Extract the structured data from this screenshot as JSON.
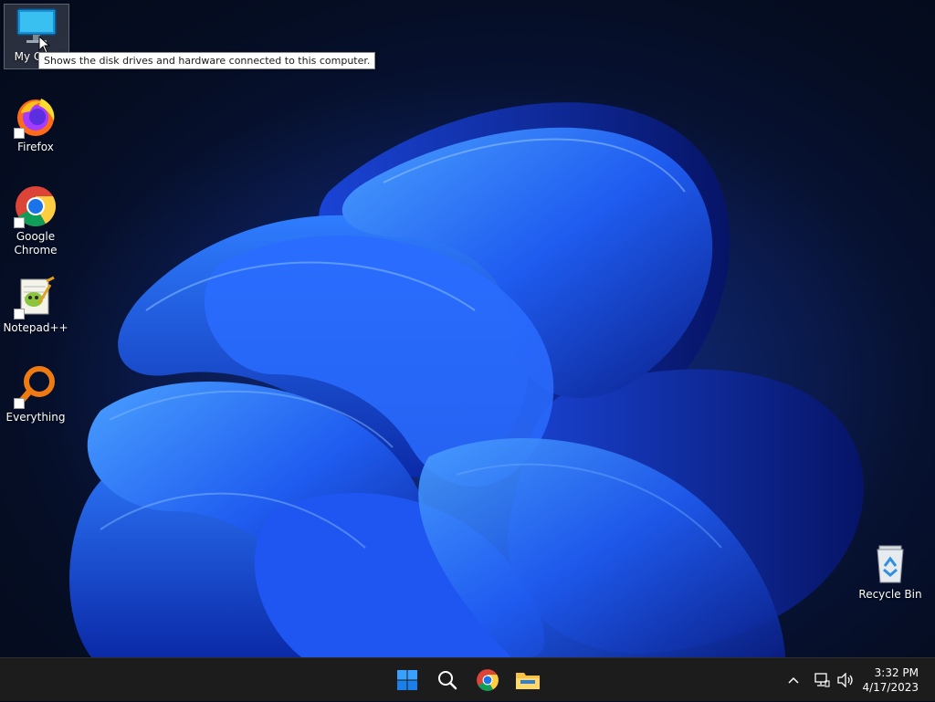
{
  "desktop": {
    "icons": [
      {
        "label": "My Computer",
        "visible_label": "My Com",
        "icon": "monitor-icon"
      },
      {
        "label": "Firefox",
        "icon": "firefox-icon"
      },
      {
        "label": "Google Chrome",
        "icon": "chrome-icon"
      },
      {
        "label": "Notepad++",
        "icon": "notepadpp-icon"
      },
      {
        "label": "Everything",
        "icon": "everything-icon"
      },
      {
        "label": "Recycle Bin",
        "icon": "recycle-bin-icon"
      }
    ],
    "tooltip": "Shows the disk drives and hardware connected to this computer."
  },
  "taskbar": {
    "buttons": [
      {
        "name": "start",
        "icon": "windows-logo-icon"
      },
      {
        "name": "search",
        "icon": "search-icon"
      },
      {
        "name": "chrome",
        "icon": "chrome-icon"
      },
      {
        "name": "file-explorer",
        "icon": "folder-icon"
      }
    ],
    "tray": {
      "chevron": "chevron-up-icon",
      "network": "network-icon",
      "volume": "speaker-icon"
    },
    "time": "3:32 PM",
    "date": "4/17/2023"
  },
  "colors": {
    "accent": "#1f6bff",
    "taskbar": "#1c1c1c",
    "background": "#050d22"
  }
}
